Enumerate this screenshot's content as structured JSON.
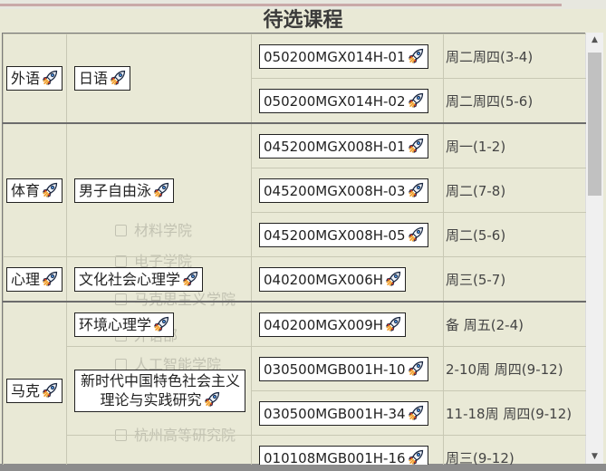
{
  "page": {
    "title": "待选课程"
  },
  "background_list": [
    "材料学院",
    "电子学院",
    "马克思主义学院",
    "外语部",
    "人工智能学院",
    "杭州高等研究院"
  ],
  "rows": [
    {
      "category": "外语",
      "course": "日语",
      "code": "050200MGX014H-01",
      "time": "周二周四(3-4)"
    },
    {
      "code": "050200MGX014H-02",
      "time": "周二周四(5-6)"
    },
    {
      "category": "体育",
      "course": "男子自由泳",
      "code": "045200MGX008H-01",
      "time": "周一(1-2)"
    },
    {
      "code": "045200MGX008H-03",
      "time": "周二(7-8)"
    },
    {
      "code": "045200MGX008H-05",
      "time": "周二(5-6)"
    },
    {
      "category": "心理",
      "course": "文化社会心理学",
      "code": "040200MGX006H",
      "time": "周三(5-7)"
    },
    {
      "course": "环境心理学",
      "code": "040200MGX009H",
      "time": "备 周五(2-4)"
    },
    {
      "category": "马克",
      "course": "新时代中国特色社会主义理论与实践研究",
      "code": "030500MGB001H-10",
      "time": "2-10周 周四(9-12)"
    },
    {
      "code": "030500MGB001H-34",
      "time": "11-18周 周四(9-12)"
    },
    {
      "code": "010108MGB001H-16",
      "time": "周三(9-12)"
    }
  ],
  "colors": {
    "background": "#e9e9d6",
    "chip": "#ffffff",
    "border": "#222222"
  },
  "icons": {
    "launch": "rocket-icon"
  }
}
